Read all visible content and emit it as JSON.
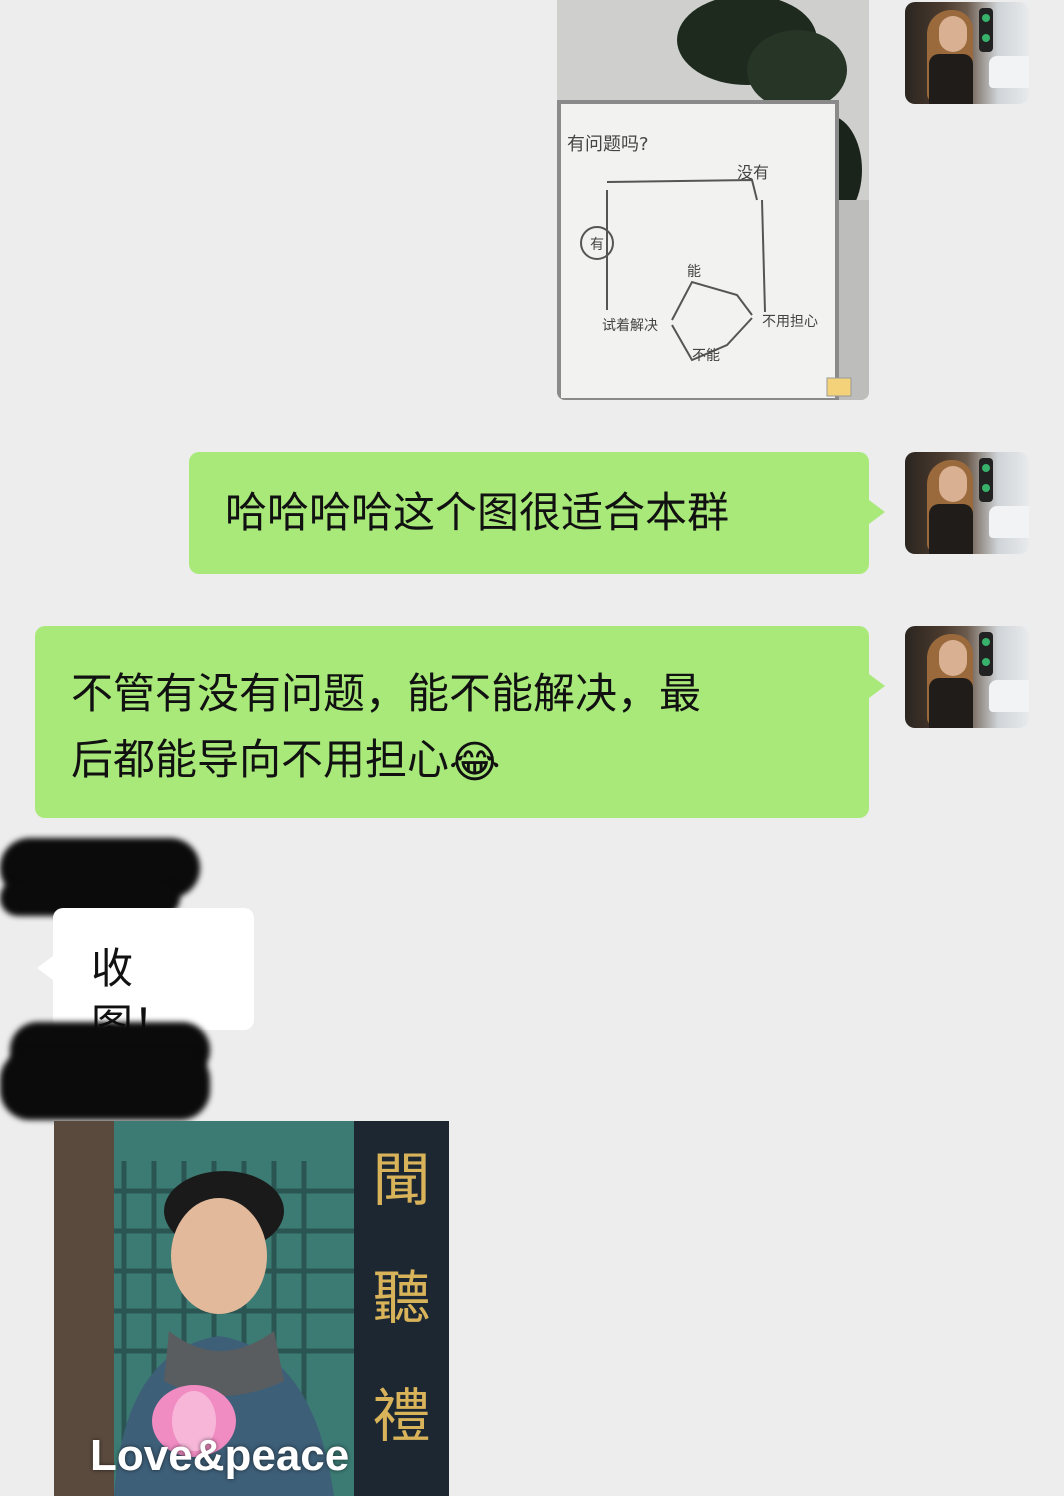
{
  "messages": [
    {
      "id": "m1",
      "side": "right",
      "type": "image",
      "image_name": "whiteboard-flowchart-photo",
      "whiteboard": {
        "question": "有问题吗?",
        "yes": "有",
        "no": "没有",
        "try": "试着解决",
        "can": "能",
        "cannot": "不能",
        "result": "不用担心"
      }
    },
    {
      "id": "m2",
      "side": "right",
      "type": "text",
      "text": "哈哈哈哈这个图很适合本群"
    },
    {
      "id": "m3",
      "side": "right",
      "type": "text",
      "line1": "不管有没有问题，能不能解决，最",
      "line2": "后都能导向不用担心",
      "emoji": "😂"
    },
    {
      "id": "m4",
      "side": "left",
      "type": "text",
      "text": "收图！"
    },
    {
      "id": "m5",
      "side": "left",
      "type": "image",
      "image_name": "love-peace-meme",
      "caption": "Love&peace",
      "sign_chars": [
        "聞",
        "聽",
        "禮"
      ]
    }
  ]
}
